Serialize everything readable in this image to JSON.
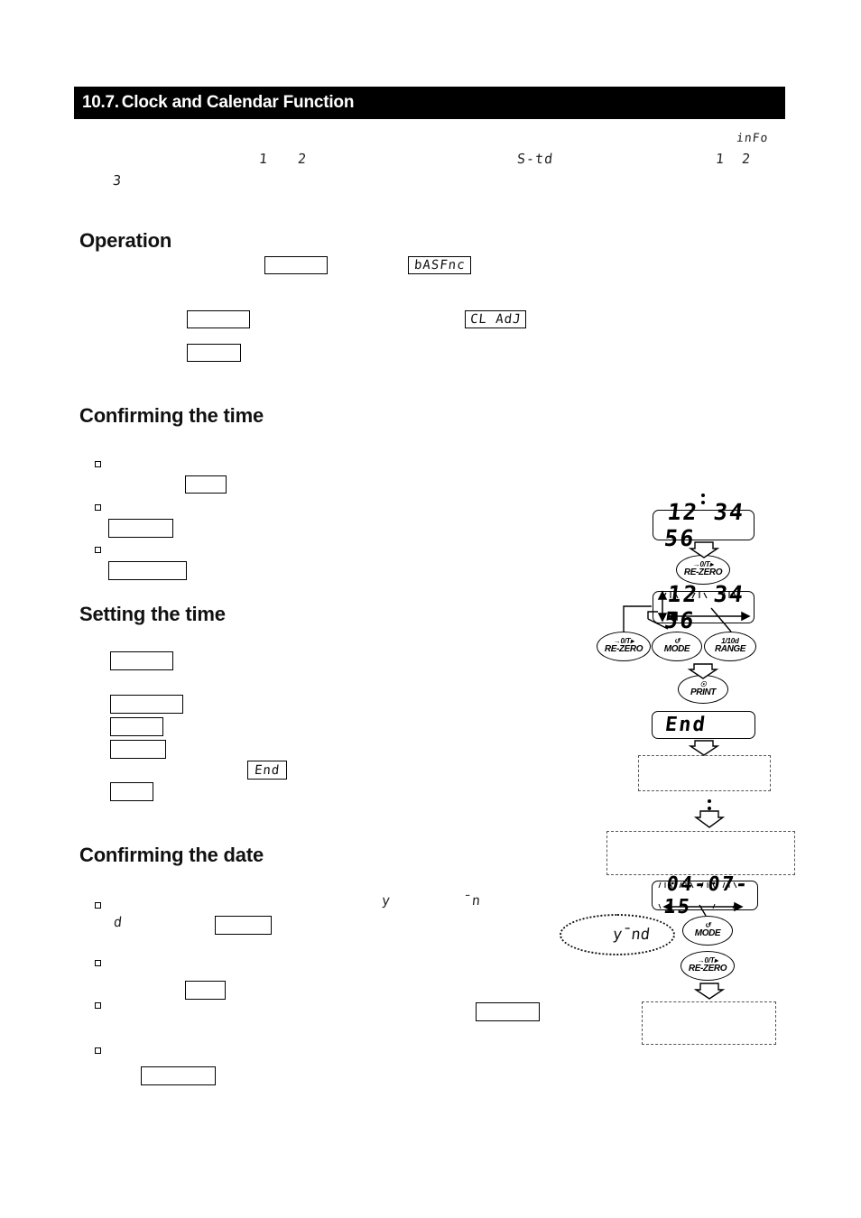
{
  "header": {
    "number": "10.7.",
    "title": "Clock and Calendar Function"
  },
  "top_markers": {
    "m1": "1",
    "m2": "2",
    "m3": "3",
    "std": "S-td",
    "n1": "1",
    "n2": "2",
    "info": "inFo"
  },
  "sections": {
    "operation": "Operation",
    "confirming_time": "Confirming the time",
    "setting_time": "Setting the time",
    "confirming_date": "Confirming the date"
  },
  "inline_segments": {
    "basfnc": "bASFnc",
    "cl_adj": "CL AdJ",
    "end": "End",
    "year": "y",
    "month": "¯ո",
    "day": "d"
  },
  "flow_time": {
    "display_static": "12 34 56",
    "display_blink": "12 34 56",
    "end_display": "End",
    "buttons": {
      "rezero_top": {
        "line1": "→0/T▸",
        "line2": "RE-ZERO"
      },
      "rezero_left": {
        "line1": "→0/T▸",
        "line2": "RE-ZERO"
      },
      "mode": {
        "line1": "↺",
        "line2": "MODE"
      },
      "range": {
        "line1": "1/10d",
        "line2": "RANGE"
      },
      "print": {
        "line1": "☉",
        "line2": "PRINT"
      }
    }
  },
  "flow_date": {
    "display_date": "04-07-15",
    "ymd_note": "y¯ոd",
    "buttons": {
      "mode": {
        "line1": "↺",
        "line2": "MODE"
      },
      "rezero": {
        "line1": "→0/T▸",
        "line2": "RE-ZERO"
      }
    }
  },
  "colors": {
    "header_bg": "#000000",
    "header_fg": "#ffffff",
    "ink": "#000000",
    "dashed": "#555555"
  }
}
